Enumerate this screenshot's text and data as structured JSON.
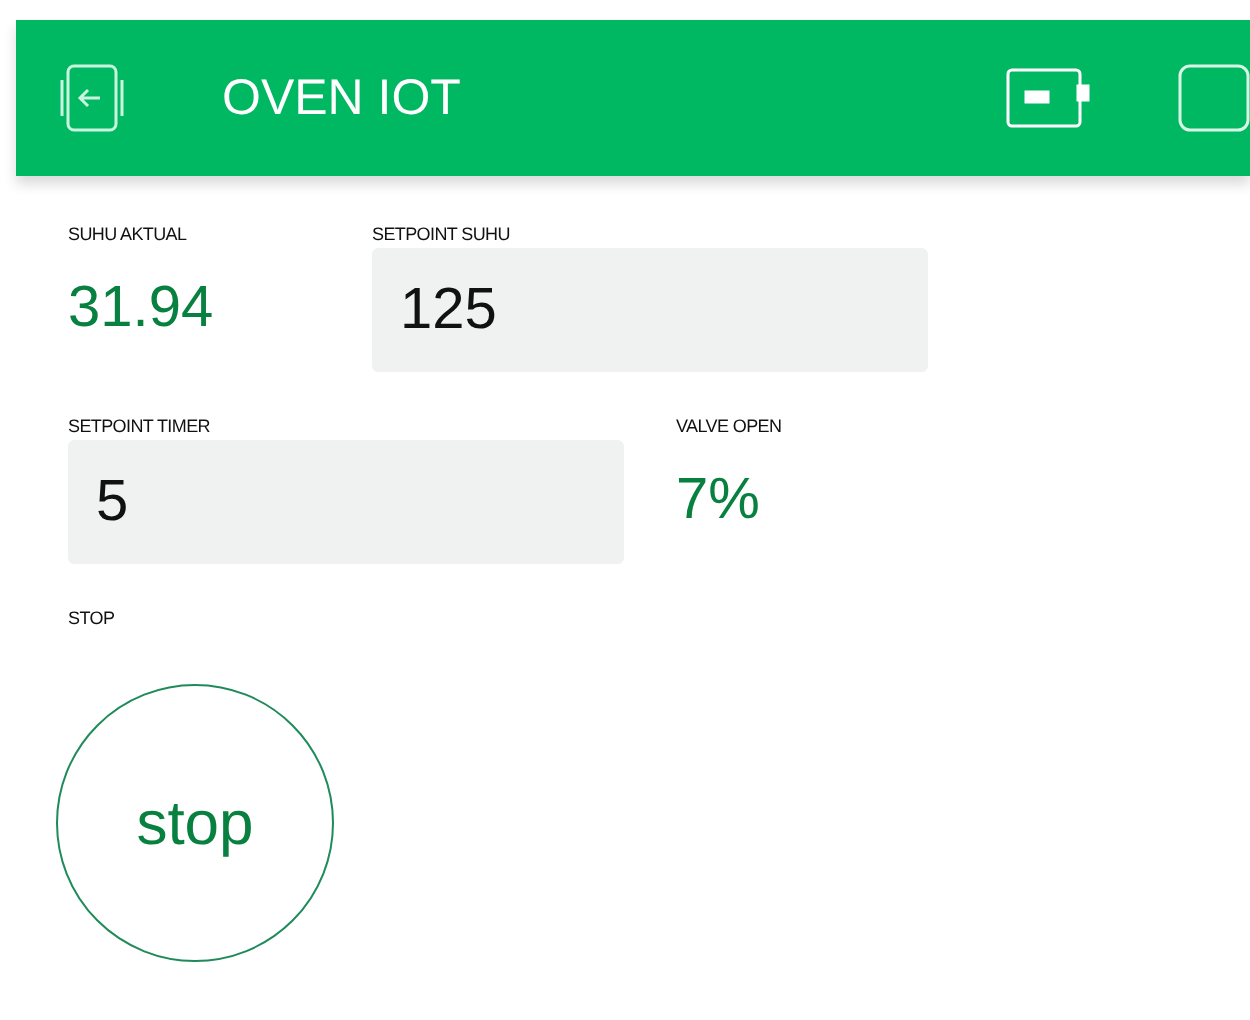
{
  "header": {
    "title": "OVEN IOT"
  },
  "rows": [
    {
      "widgets": [
        {
          "kind": "display",
          "label": "SUHU AKTUAL",
          "value": "31.94"
        },
        {
          "kind": "input",
          "label": "SETPOINT SUHU",
          "value": "125"
        }
      ]
    },
    {
      "widgets": [
        {
          "kind": "input",
          "label": "SETPOINT TIMER",
          "value": "5"
        },
        {
          "kind": "display",
          "label": "VALVE OPEN",
          "value": "7%"
        }
      ]
    },
    {
      "widgets": [
        {
          "kind": "button",
          "label": "STOP",
          "value": "stop"
        }
      ]
    }
  ]
}
